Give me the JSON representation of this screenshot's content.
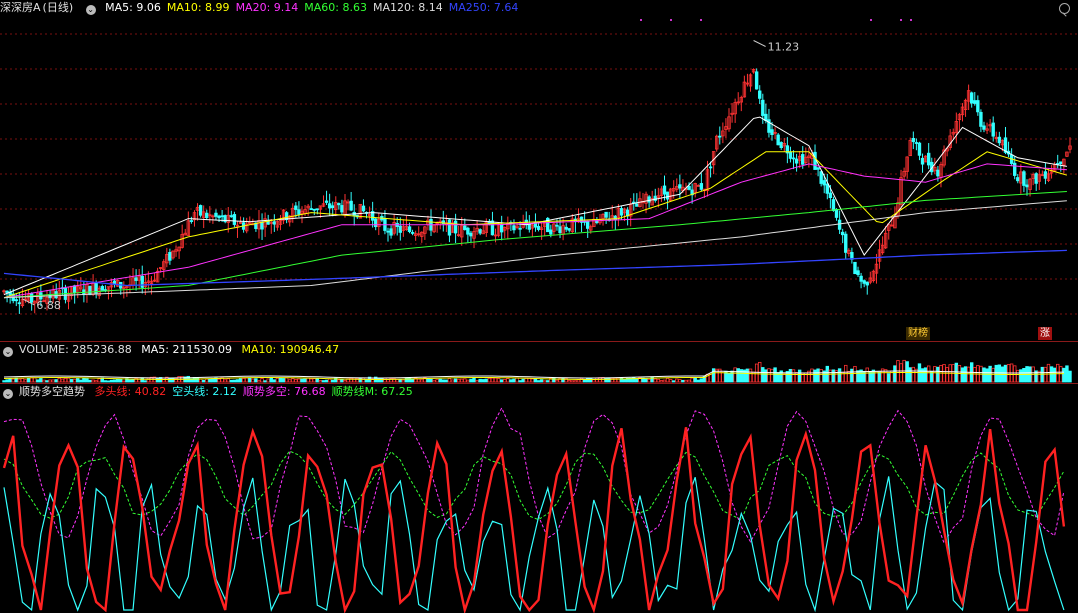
{
  "main": {
    "stock_name": "深深房A",
    "period": "(日线)",
    "ma_legend": [
      {
        "label": "MA5: 9.06",
        "color": "#ffffff"
      },
      {
        "label": "MA10: 8.99",
        "color": "#ffff00"
      },
      {
        "label": "MA20: 9.14",
        "color": "#ff33ff"
      },
      {
        "label": "MA60: 8.63",
        "color": "#33ff33"
      },
      {
        "label": "MA120: 8.14",
        "color": "#dddddd"
      },
      {
        "label": "MA250: 7.64",
        "color": "#3344ff"
      }
    ],
    "high_label": "11.23",
    "low_label": "6.88",
    "tag_1": "财榜",
    "tag_2": "涨"
  },
  "volume": {
    "title": "VOLUME: 285236.88",
    "ma5": "MA5: 211530.09",
    "ma10": "MA10: 190946.47"
  },
  "indicator": {
    "title": "顺势多空趋势",
    "legend": [
      {
        "label": "多头线: 40.82",
        "color": "#ff2222"
      },
      {
        "label": "空头线: 2.12",
        "color": "#33ffff"
      },
      {
        "label": "顺势多空: 76.68",
        "color": "#ff33ff"
      },
      {
        "label": "顺势线M: 67.25",
        "color": "#33ff33"
      }
    ]
  },
  "colors": {
    "up": "#ff3333",
    "down": "#33ffff",
    "grid": "#7a1010"
  },
  "chart_data": [
    {
      "type": "candlestick",
      "title": "深深房A (日线)",
      "y_range": [
        6.6,
        11.6
      ],
      "annotations": {
        "high": 11.23,
        "low": 6.88
      },
      "key_points": [
        [
          0,
          7.1
        ],
        [
          8,
          6.95
        ],
        [
          16,
          7.05
        ],
        [
          24,
          7.1
        ],
        [
          32,
          7.2
        ],
        [
          40,
          7.2
        ],
        [
          48,
          7.3
        ],
        [
          55,
          7.75
        ],
        [
          62,
          8.4
        ],
        [
          70,
          8.3
        ],
        [
          78,
          8.2
        ],
        [
          86,
          8.25
        ],
        [
          94,
          8.4
        ],
        [
          102,
          8.5
        ],
        [
          110,
          8.5
        ],
        [
          118,
          8.4
        ],
        [
          124,
          8.15
        ],
        [
          132,
          8.1
        ],
        [
          140,
          8.2
        ],
        [
          148,
          8.1
        ],
        [
          156,
          8.15
        ],
        [
          162,
          8.1
        ],
        [
          170,
          8.2
        ],
        [
          178,
          8.15
        ],
        [
          186,
          8.2
        ],
        [
          192,
          8.2
        ],
        [
          200,
          8.4
        ],
        [
          206,
          8.5
        ],
        [
          212,
          8.7
        ],
        [
          220,
          8.75
        ],
        [
          228,
          8.85
        ],
        [
          232,
          9.6
        ],
        [
          238,
          10.2
        ],
        [
          244,
          10.8
        ],
        [
          247,
          9.9
        ],
        [
          252,
          9.6
        ],
        [
          258,
          9.3
        ],
        [
          263,
          9.3
        ],
        [
          268,
          8.7
        ],
        [
          272,
          8.1
        ],
        [
          276,
          7.55
        ],
        [
          280,
          7.2
        ],
        [
          284,
          7.6
        ],
        [
          290,
          8.4
        ],
        [
          295,
          9.6
        ],
        [
          299,
          9.3
        ],
        [
          304,
          9.1
        ],
        [
          309,
          9.8
        ],
        [
          314,
          10.4
        ],
        [
          318,
          9.9
        ],
        [
          324,
          9.6
        ],
        [
          330,
          9.0
        ],
        [
          334,
          8.9
        ],
        [
          340,
          9.1
        ],
        [
          344,
          9.3
        ],
        [
          347,
          9.5
        ]
      ],
      "ma_series": {
        "MA5": [
          [
            0,
            7.05
          ],
          [
            60,
            8.3
          ],
          [
            80,
            8.25
          ],
          [
            120,
            8.4
          ],
          [
            170,
            8.2
          ],
          [
            220,
            8.7
          ],
          [
            245,
            10.0
          ],
          [
            262,
            9.5
          ],
          [
            280,
            7.7
          ],
          [
            300,
            9.0
          ],
          [
            312,
            9.8
          ],
          [
            330,
            9.3
          ],
          [
            347,
            9.15
          ]
        ],
        "MA10": [
          [
            0,
            7.0
          ],
          [
            60,
            8.0
          ],
          [
            100,
            8.4
          ],
          [
            150,
            8.2
          ],
          [
            200,
            8.3
          ],
          [
            230,
            8.8
          ],
          [
            248,
            9.4
          ],
          [
            262,
            9.4
          ],
          [
            285,
            8.2
          ],
          [
            305,
            8.9
          ],
          [
            320,
            9.4
          ],
          [
            347,
            9.0
          ]
        ],
        "MA20": [
          [
            0,
            7.0
          ],
          [
            60,
            7.5
          ],
          [
            110,
            8.2
          ],
          [
            160,
            8.2
          ],
          [
            210,
            8.3
          ],
          [
            240,
            8.9
          ],
          [
            262,
            9.2
          ],
          [
            280,
            9.0
          ],
          [
            300,
            8.9
          ],
          [
            320,
            9.2
          ],
          [
            347,
            9.1
          ]
        ],
        "MA60": [
          [
            0,
            7.0
          ],
          [
            60,
            7.2
          ],
          [
            110,
            7.7
          ],
          [
            160,
            7.95
          ],
          [
            220,
            8.2
          ],
          [
            262,
            8.4
          ],
          [
            300,
            8.6
          ],
          [
            347,
            8.75
          ]
        ],
        "MA120": [
          [
            0,
            7.0
          ],
          [
            100,
            7.2
          ],
          [
            180,
            7.7
          ],
          [
            240,
            8.0
          ],
          [
            270,
            8.2
          ],
          [
            300,
            8.4
          ],
          [
            347,
            8.6
          ]
        ],
        "MA250": [
          [
            0,
            7.4
          ],
          [
            40,
            7.2
          ],
          [
            100,
            7.3
          ],
          [
            180,
            7.45
          ],
          [
            240,
            7.55
          ],
          [
            300,
            7.7
          ],
          [
            347,
            7.78
          ]
        ]
      }
    },
    {
      "type": "bar",
      "title": "VOLUME",
      "values_note_free": true,
      "last_value": 285236.88,
      "ma5": 211530.09,
      "ma10": 190946.47
    },
    {
      "type": "line",
      "title": "顺势多空趋势",
      "y_range": [
        0,
        100
      ],
      "series": [
        {
          "name": "多头线",
          "last": 40.82
        },
        {
          "name": "空头线",
          "last": 2.12
        },
        {
          "name": "顺势多空",
          "last": 76.68
        },
        {
          "name": "顺势线M",
          "last": 67.25
        }
      ]
    }
  ]
}
